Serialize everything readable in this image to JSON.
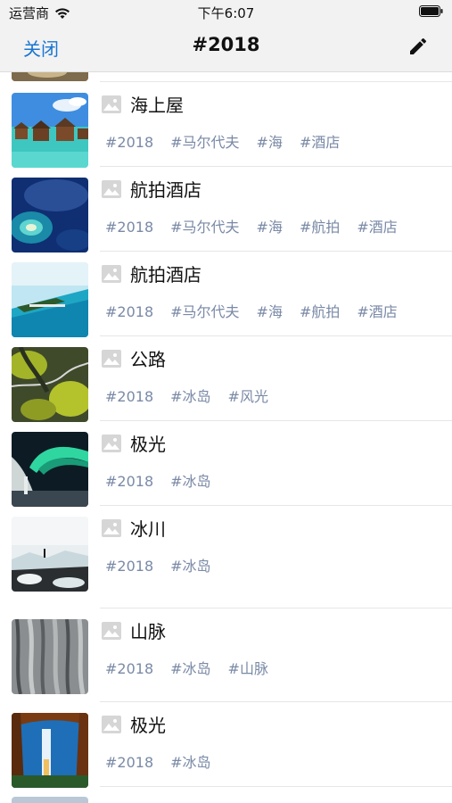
{
  "status": {
    "carrier": "运营商",
    "time": "下午6:07"
  },
  "nav": {
    "close_label": "关闭",
    "title": "#2018"
  },
  "items": [
    {
      "title": "海上屋",
      "tags": [
        "#2018",
        "#马尔代夫",
        "#海",
        "#酒店"
      ]
    },
    {
      "title": "航拍酒店",
      "tags": [
        "#2018",
        "#马尔代夫",
        "#海",
        "#航拍",
        "#酒店"
      ]
    },
    {
      "title": "航拍酒店",
      "tags": [
        "#2018",
        "#马尔代夫",
        "#海",
        "#航拍",
        "#酒店"
      ]
    },
    {
      "title": "公路",
      "tags": [
        "#2018",
        "#冰岛",
        "#风光"
      ]
    },
    {
      "title": "极光",
      "tags": [
        "#2018",
        "#冰岛"
      ]
    },
    {
      "title": "冰川",
      "tags": [
        "#2018",
        "#冰岛"
      ]
    },
    {
      "title": "山脉",
      "tags": [
        "#2018",
        "#冰岛",
        "#山脉"
      ]
    },
    {
      "title": "极光",
      "tags": [
        "#2018",
        "#冰岛"
      ]
    }
  ],
  "colors": {
    "accent": "#1976d2",
    "tag": "#7a8aa6",
    "bar": "#f2f2f2"
  }
}
